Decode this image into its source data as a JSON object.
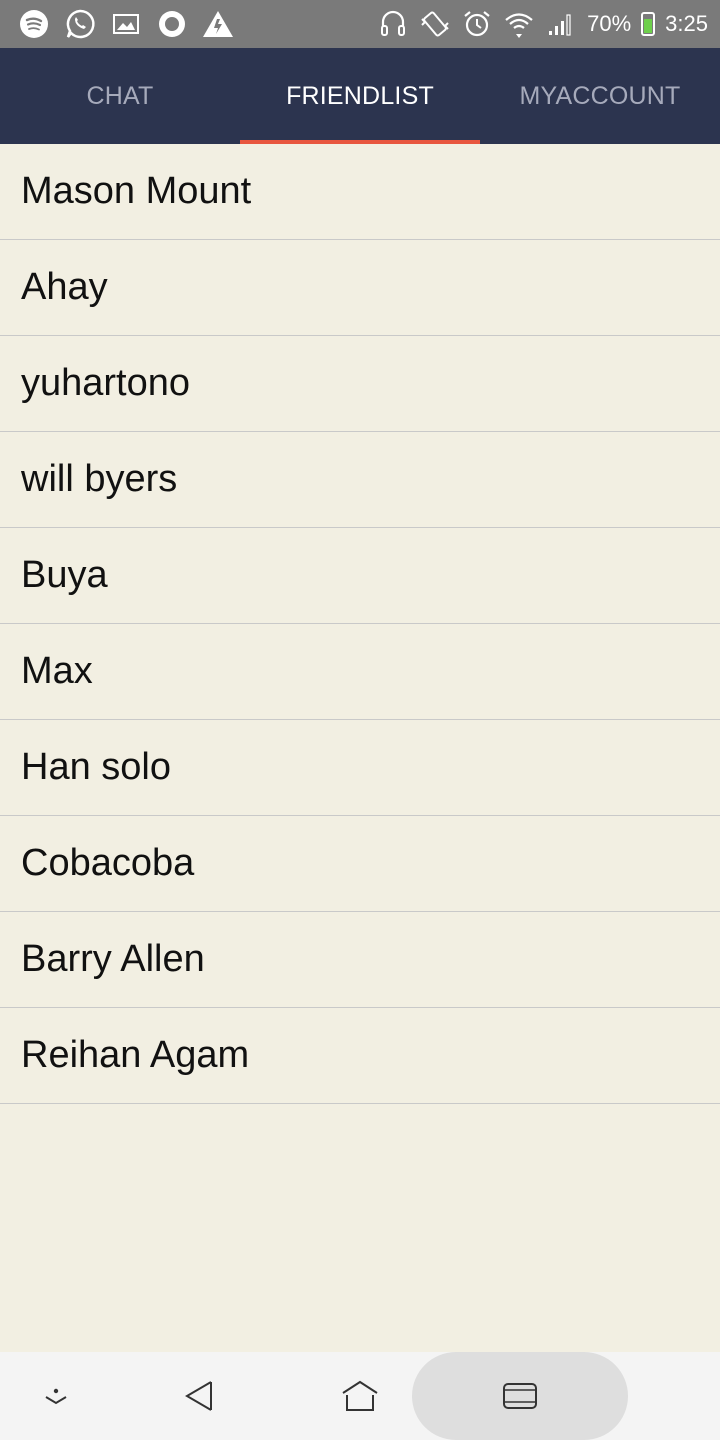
{
  "status_bar": {
    "left_icons": [
      "spotify-icon",
      "whatsapp-icon",
      "image-icon",
      "circle-app-icon",
      "warning-icon"
    ],
    "right_icons": [
      "headset-icon",
      "vibrate-icon",
      "alarm-icon",
      "wifi-icon",
      "signal-icon",
      "battery-icon"
    ],
    "battery_percent": "70%",
    "time": "3:25"
  },
  "tabs": [
    {
      "label": "CHAT",
      "active": false
    },
    {
      "label": "FRIENDLIST",
      "active": true
    },
    {
      "label": "MYACCOUNT",
      "active": false
    }
  ],
  "friends": [
    "Mason Mount",
    "Ahay",
    "yuhartono",
    "will byers",
    "Buya",
    "Max",
    "Han solo",
    "Cobacoba",
    "Barry Allen",
    "Reihan Agam"
  ],
  "nav_bar": {
    "icons": [
      "hide-keyboard-icon",
      "back-icon",
      "home-icon",
      "recents-icon"
    ]
  },
  "colors": {
    "header_bg": "#2c344f",
    "tab_indicator": "#e8563f",
    "list_bg": "#f2efe2"
  }
}
